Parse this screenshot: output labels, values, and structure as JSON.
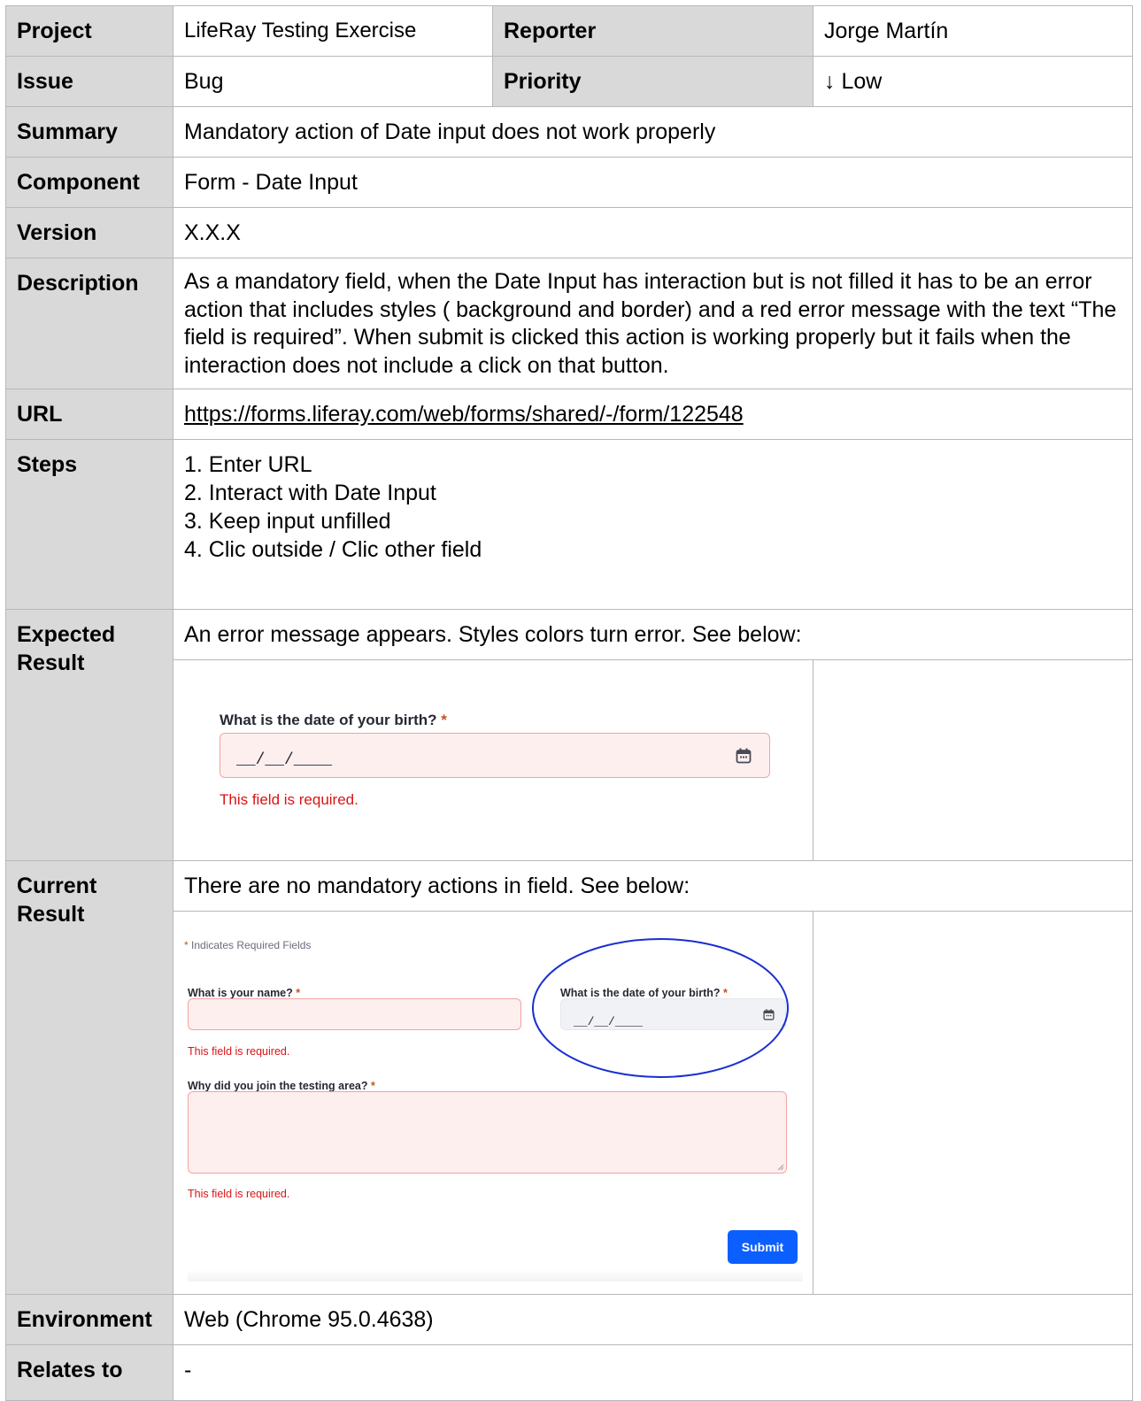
{
  "rows": {
    "project": {
      "label": "Project",
      "value": "LifeRay Testing Exercise"
    },
    "reporter": {
      "label": "Reporter",
      "value": "Jorge Martín"
    },
    "issue": {
      "label": "Issue",
      "value": "Bug"
    },
    "priority": {
      "label": "Priority",
      "value": "↓ Low"
    },
    "summary": {
      "label": "Summary",
      "value": "Mandatory action of Date input does not work properly"
    },
    "component": {
      "label": "Component",
      "value": "Form - Date Input"
    },
    "version": {
      "label": "Version",
      "value": "X.X.X"
    },
    "description": {
      "label": "Description",
      "value": "As a mandatory field, when the Date Input has interaction but is not filled it has to be an error action that includes styles ( background and border) and a red error message with the text “The field is required”. When submit is clicked this action is working properly but it fails when the interaction does not include a click on that button."
    },
    "url": {
      "label": "URL",
      "value": "https://forms.liferay.com/web/forms/shared/-/form/122548"
    },
    "steps": {
      "label": "Steps",
      "items": [
        "1. Enter URL",
        "2. Interact with Date Input",
        "3. Keep input unfilled",
        "4. Clic outside / Clic other field"
      ]
    },
    "expected": {
      "label_line1": "Expected",
      "label_line2": "Result",
      "value": "An error message appears. Styles colors turn error. See below:"
    },
    "current": {
      "label_line1": "Current",
      "label_line2": "Result",
      "value": "There are no mandatory actions in field. See below:"
    },
    "environment": {
      "label": "Environment",
      "value": "Web (Chrome 95.0.4638)"
    },
    "relates": {
      "label": "Relates to",
      "value": "-"
    }
  },
  "expected_shot": {
    "label": "What is the date of your birth?",
    "required_mark": "*",
    "mask": "__/__/____",
    "error": "This field is required.",
    "icon": "calendar-icon"
  },
  "current_shot": {
    "required_note_mark": "*",
    "required_note": "Indicates Required Fields",
    "name_label": "What is your name?",
    "name_error": "This field is required.",
    "birth_label": "What is the date of your birth?",
    "birth_mask": "__/__/____",
    "why_label": "Why did you join the testing area?",
    "why_error": "This field is required.",
    "required_mark": "*",
    "submit_label": "Submit",
    "highlight_color": "#1a2fd1",
    "icon": "calendar-icon"
  },
  "colors": {
    "header_bg": "#d9d9d9",
    "error_red": "#da1414",
    "error_bg": "#feefef",
    "submit_blue": "#0b5fff"
  }
}
